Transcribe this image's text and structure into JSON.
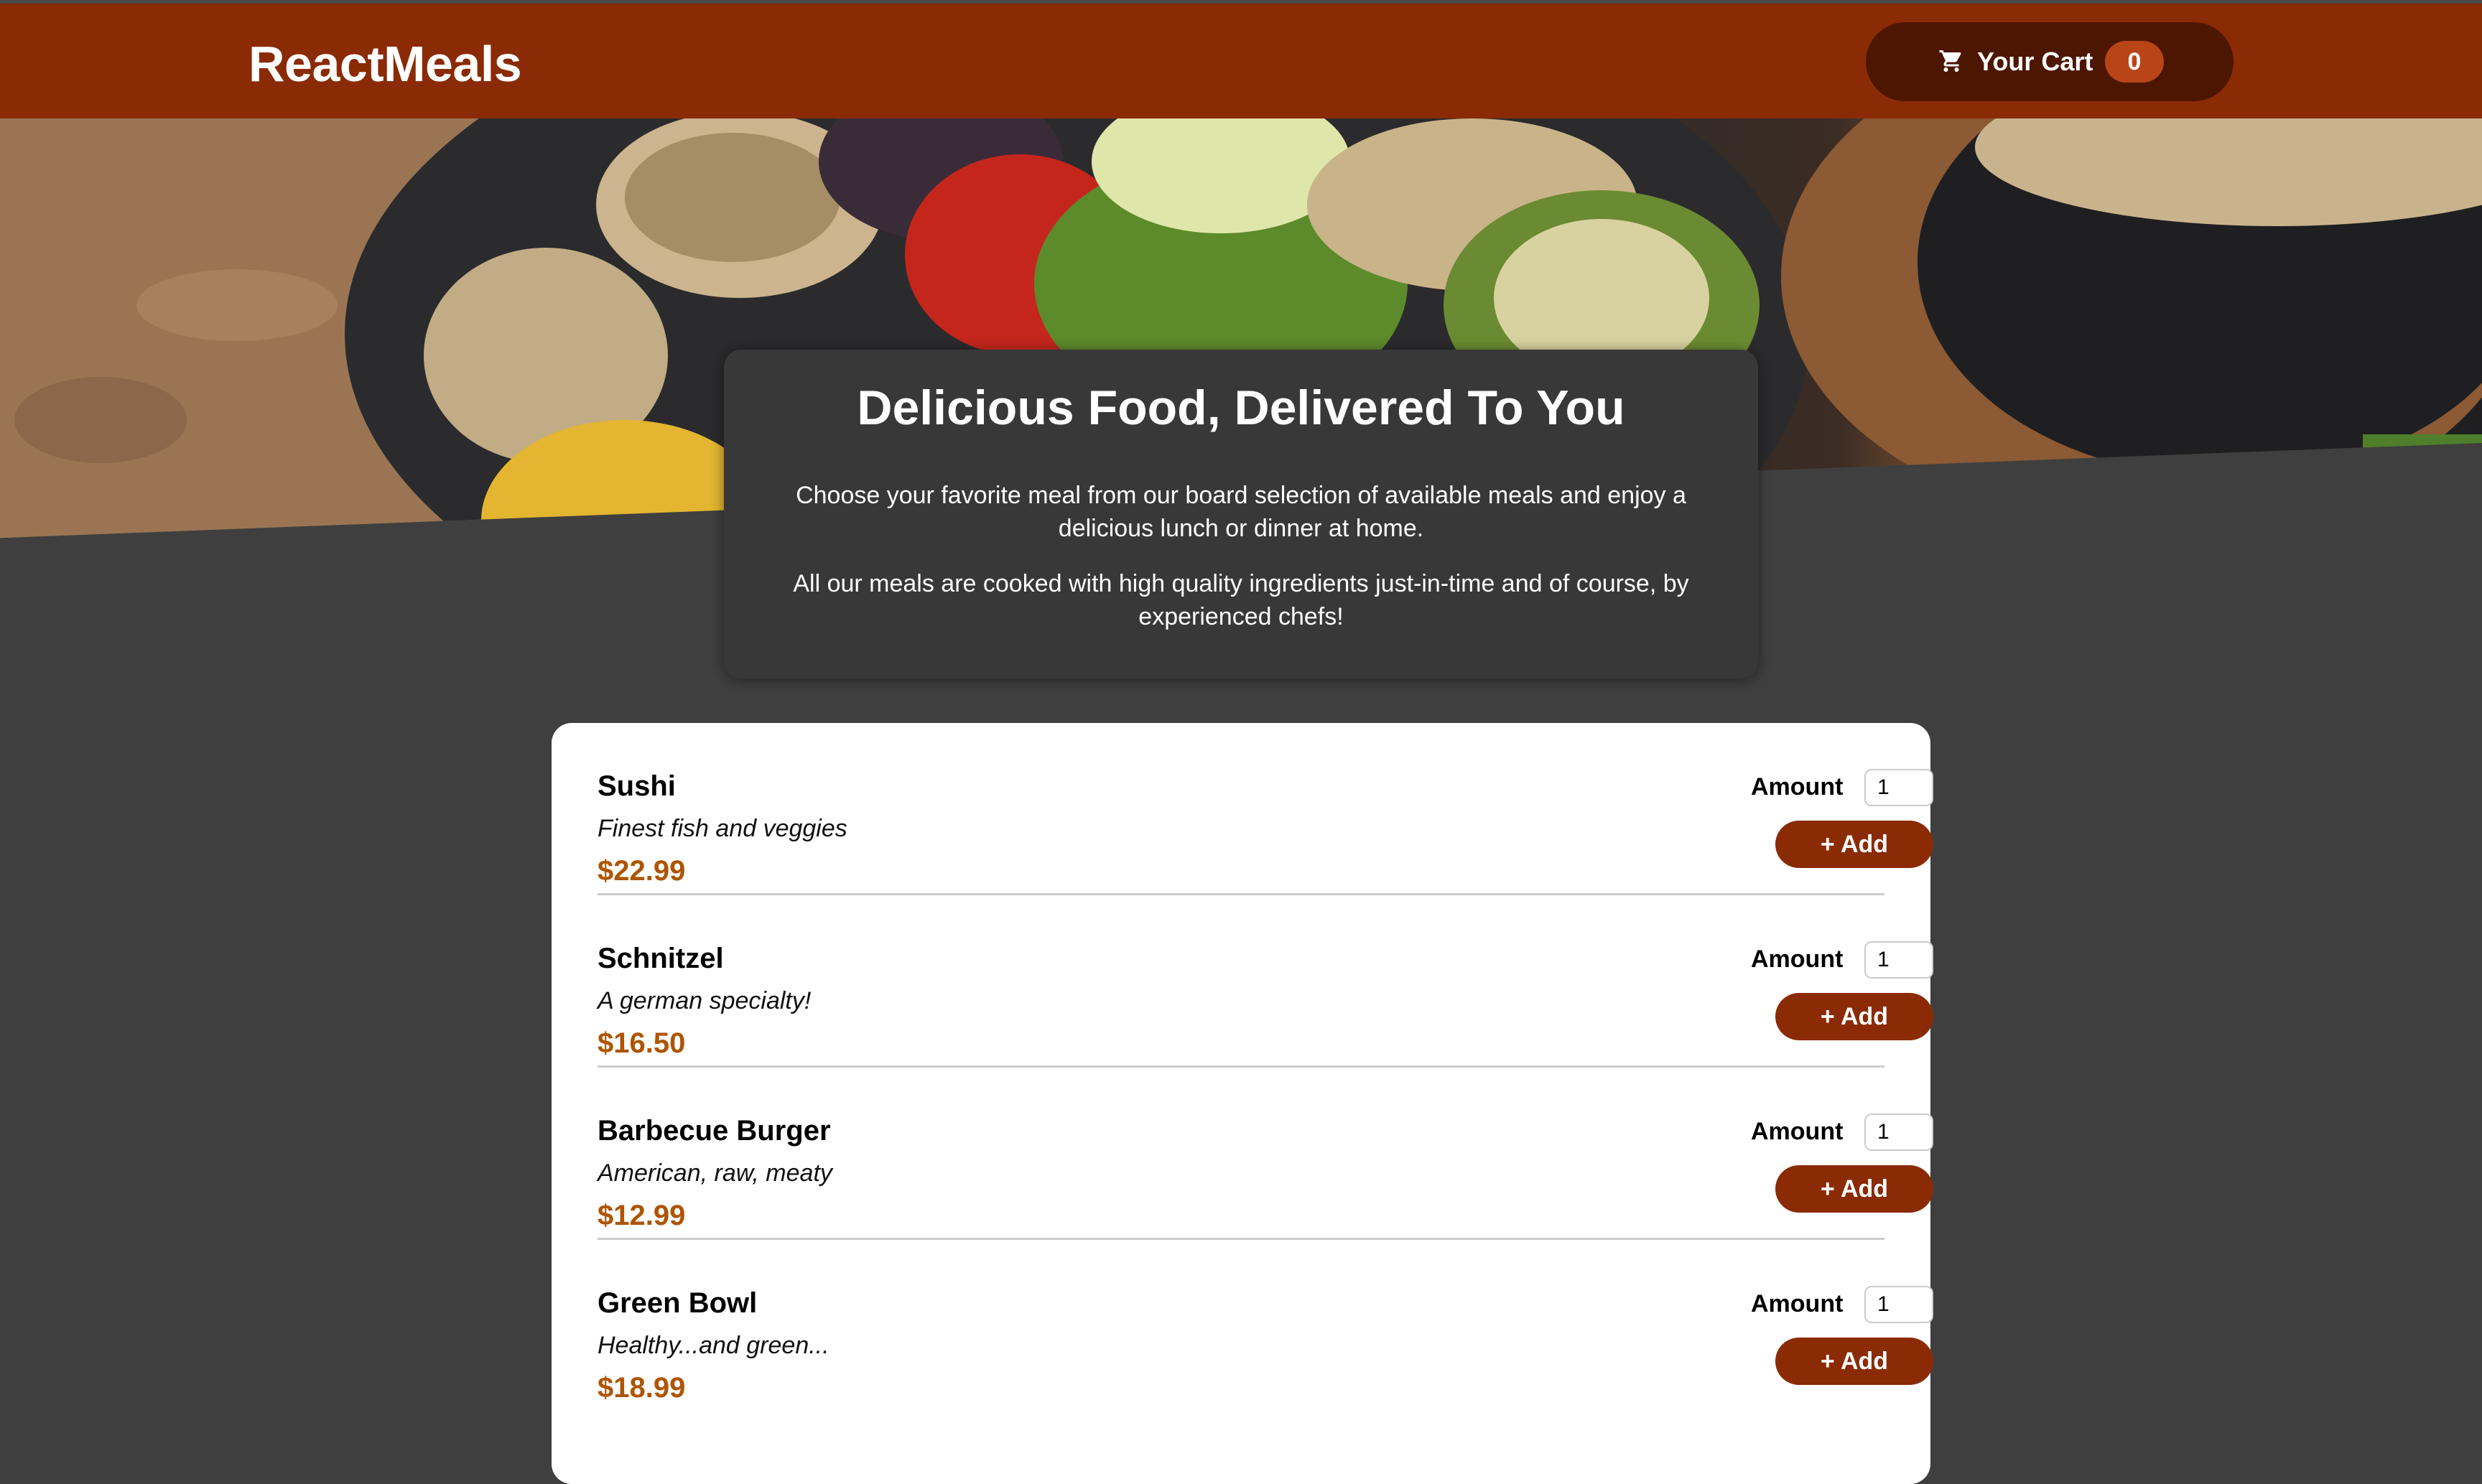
{
  "header": {
    "brand": "ReactMeals",
    "cart": {
      "icon": "cart-icon",
      "label": "Your Cart",
      "count": "0"
    }
  },
  "summary": {
    "title": "Delicious Food, Delivered To You",
    "paragraph1": "Choose your favorite meal from our board selection of available meals and enjoy a delicious lunch or dinner at home.",
    "paragraph2": "All our meals are cooked with high quality ingredients just-in-time and of course, by experienced chefs!"
  },
  "meals": [
    {
      "name": "Sushi",
      "description": "Finest fish and veggies",
      "price": "$22.99",
      "amount_label": "Amount",
      "amount": "1",
      "add_label": "+ Add"
    },
    {
      "name": "Schnitzel",
      "description": "A german specialty!",
      "price": "$16.50",
      "amount_label": "Amount",
      "amount": "1",
      "add_label": "+ Add"
    },
    {
      "name": "Barbecue Burger",
      "description": "American, raw, meaty",
      "price": "$12.99",
      "amount_label": "Amount",
      "amount": "1",
      "add_label": "+ Add"
    },
    {
      "name": "Green Bowl",
      "description": "Healthy...and green...",
      "price": "$18.99",
      "amount_label": "Amount",
      "amount": "1",
      "add_label": "+ Add"
    }
  ],
  "colors": {
    "header": "#8a2b06",
    "cart_button": "#4d1601",
    "badge": "#b94517",
    "page_background": "#3f3f3f",
    "price": "#ad5502"
  }
}
